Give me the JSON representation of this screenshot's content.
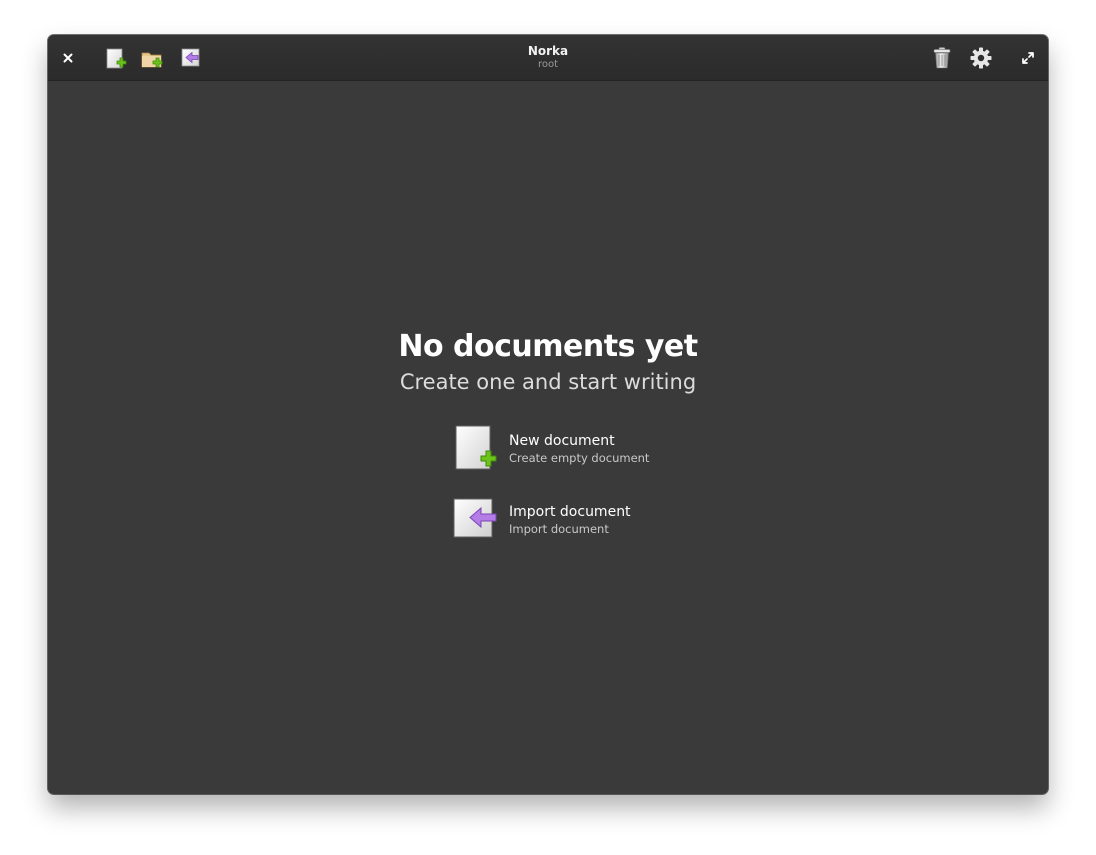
{
  "window": {
    "title": "Norka",
    "subtitle": "root"
  },
  "headerbar": {
    "left_icons": [
      "close-icon",
      "new-document-icon",
      "new-folder-icon",
      "import-document-icon"
    ],
    "right_icons": [
      "trash-icon",
      "gear-icon",
      "maximize-icon"
    ]
  },
  "empty_state": {
    "title": "No documents yet",
    "subtitle": "Create one and start writing",
    "actions": [
      {
        "label": "New document",
        "description": "Create empty document",
        "icon": "new-document-icon"
      },
      {
        "label": "Import document",
        "description": "Import document",
        "icon": "import-document-icon"
      }
    ]
  },
  "colors": {
    "background": "#3a3a3a",
    "headerbar": "#2e2e2e",
    "add_green": "#6cc31c",
    "import_purple": "#b37ce6"
  }
}
